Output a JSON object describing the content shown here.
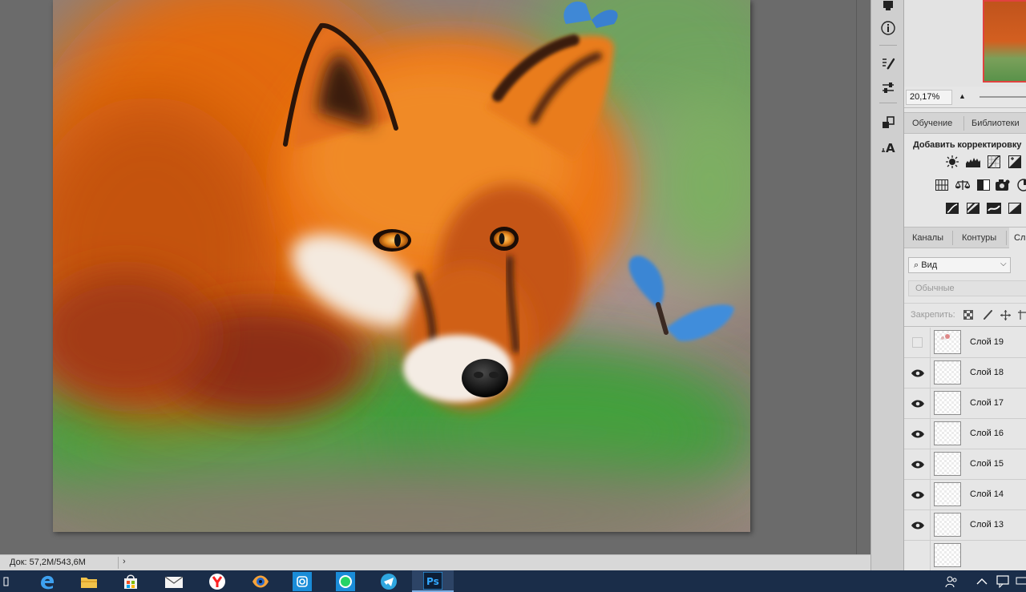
{
  "status_bar": {
    "doc_info": "Док: 57,2M/543,6M",
    "arrow": "›"
  },
  "navigator": {
    "zoom": "20,17%"
  },
  "tab_group_1": {
    "tabs": [
      "Обучение",
      "Библиотеки"
    ]
  },
  "adjustments": {
    "title": "Добавить корректировку",
    "row1": [
      "brightness-contrast-icon",
      "levels-icon",
      "curves-icon",
      "exposure-icon"
    ],
    "row2": [
      "vibrance-icon",
      "color-balance-icon",
      "black-white-icon",
      "photo-filter-icon",
      "channel-mixer-icon"
    ],
    "row3": [
      "invert-icon",
      "posterize-icon",
      "gradient-map-icon",
      "selective-color-icon"
    ]
  },
  "tab_group_2": {
    "tabs": [
      "Каналы",
      "Контуры",
      "Сл"
    ]
  },
  "layers_panel": {
    "filter_value": "Вид",
    "filter_icon": "⌕",
    "blend_mode": "Обычные",
    "lock_label": "Закрепить:",
    "layers": [
      {
        "name": "Слой 19",
        "visible": false
      },
      {
        "name": "Слой 18",
        "visible": true
      },
      {
        "name": "Слой 17",
        "visible": true
      },
      {
        "name": "Слой 16",
        "visible": true
      },
      {
        "name": "Слой 15",
        "visible": true
      },
      {
        "name": "Слой 14",
        "visible": true
      },
      {
        "name": "Слой 13",
        "visible": true
      }
    ]
  },
  "taskbar": {
    "apps": [
      "edge-icon",
      "file-explorer-icon",
      "store-icon",
      "mail-icon",
      "yandex-browser-icon",
      "eye-app-icon",
      "instagram-icon",
      "whatsapp-icon",
      "telegram-icon",
      "photoshop-icon"
    ],
    "photoshop_label": "Ps",
    "tray": [
      "people-icon",
      "tray-chevron-icon",
      "notification-icon"
    ]
  }
}
